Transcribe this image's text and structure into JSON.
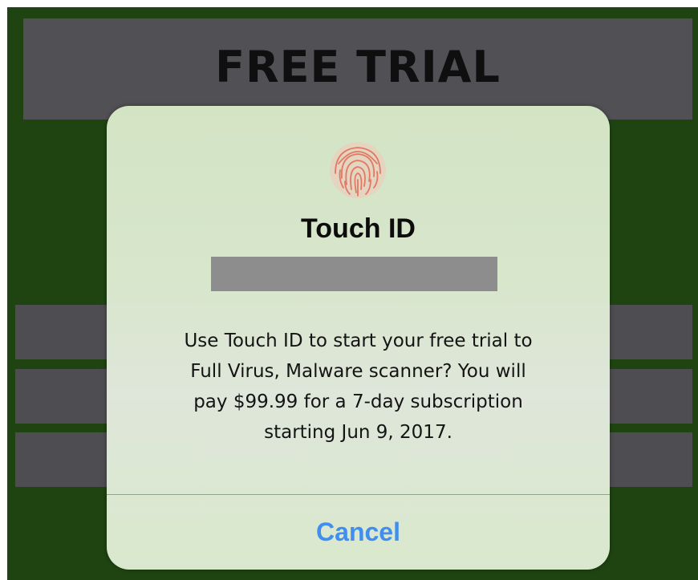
{
  "background": {
    "banner_title": "FREE TRIAL"
  },
  "dialog": {
    "icon": "fingerprint-icon",
    "title": "Touch ID",
    "message_lines": [
      "Use Touch ID to start your free trial to",
      "Full Virus, Malware scanner? You will",
      "pay $99.99 for a 7-day subscription",
      "starting Jun 9, 2017."
    ],
    "cancel_label": "Cancel"
  },
  "colors": {
    "app_background": "#1f4411",
    "banner": "#515054",
    "dialog_tint": "#d8e6cc",
    "cancel_accent": "#3f8ef0",
    "redaction": "#8d8d8d",
    "fingerprint": "#e48270"
  }
}
